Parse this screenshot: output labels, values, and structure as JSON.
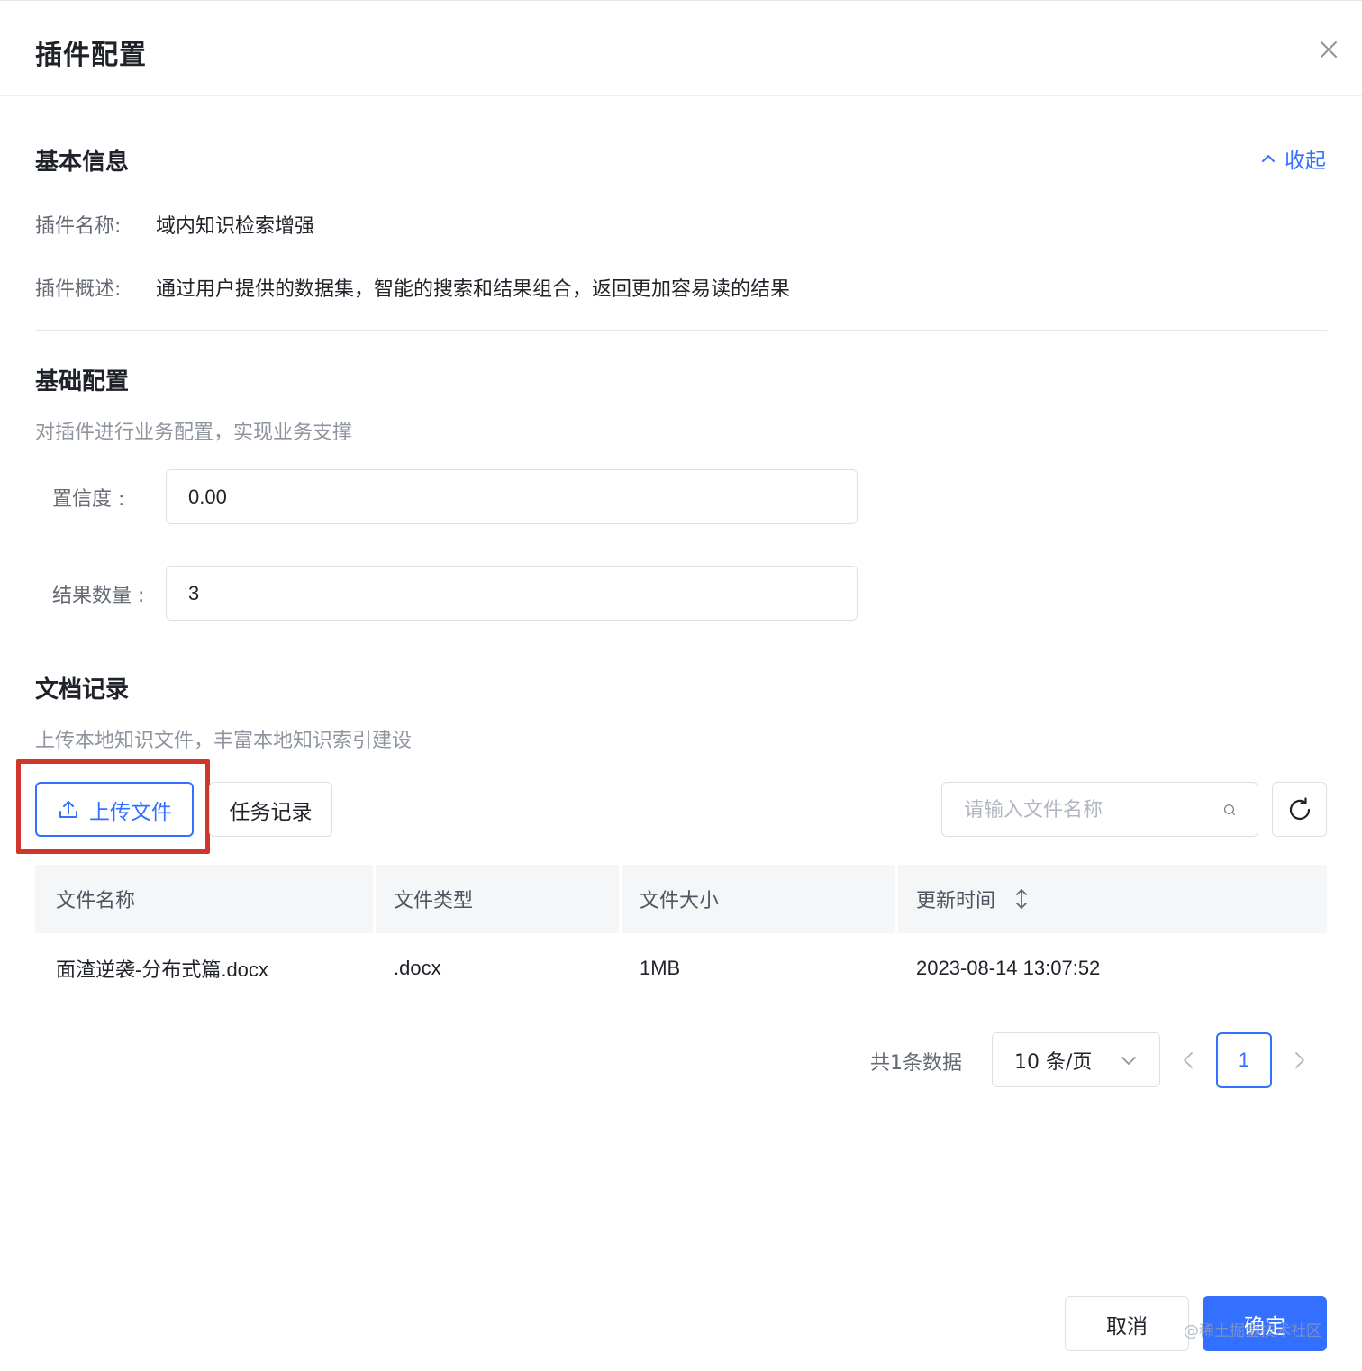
{
  "modal": {
    "title": "插件配置"
  },
  "basic_info": {
    "title": "基本信息",
    "collapse_label": "收起",
    "name_label": "插件名称:",
    "name_value": "域内知识检索增强",
    "desc_label": "插件概述:",
    "desc_value": "通过用户提供的数据集，智能的搜索和结果组合，返回更加容易读的结果"
  },
  "basic_config": {
    "title": "基础配置",
    "description": "对插件进行业务配置，实现业务支撑",
    "confidence_label": "置信度 :",
    "confidence_value": "0.00",
    "result_count_label": "结果数量 :",
    "result_count_value": "3"
  },
  "doc_records": {
    "title": "文档记录",
    "description": "上传本地知识文件，丰富本地知识索引建设",
    "upload_label": "上传文件",
    "task_label": "任务记录",
    "search_placeholder": "请输入文件名称"
  },
  "table": {
    "headers": [
      "文件名称",
      "文件类型",
      "文件大小",
      "更新时间"
    ],
    "rows": [
      [
        "面渣逆袭-分布式篇.docx",
        ".docx",
        "1MB",
        "2023-08-14 13:07:52"
      ]
    ]
  },
  "pagination": {
    "total_text": "共1条数据",
    "page_size": "10 条/页",
    "current_page": "1"
  },
  "footer": {
    "cancel_label": "取消",
    "confirm_label": "确定",
    "watermark": "@稀土掘金技术社区"
  },
  "colors": {
    "accent": "#3370ff",
    "highlight": "#d0362b",
    "text": "#1f2329",
    "muted": "#646a73"
  }
}
